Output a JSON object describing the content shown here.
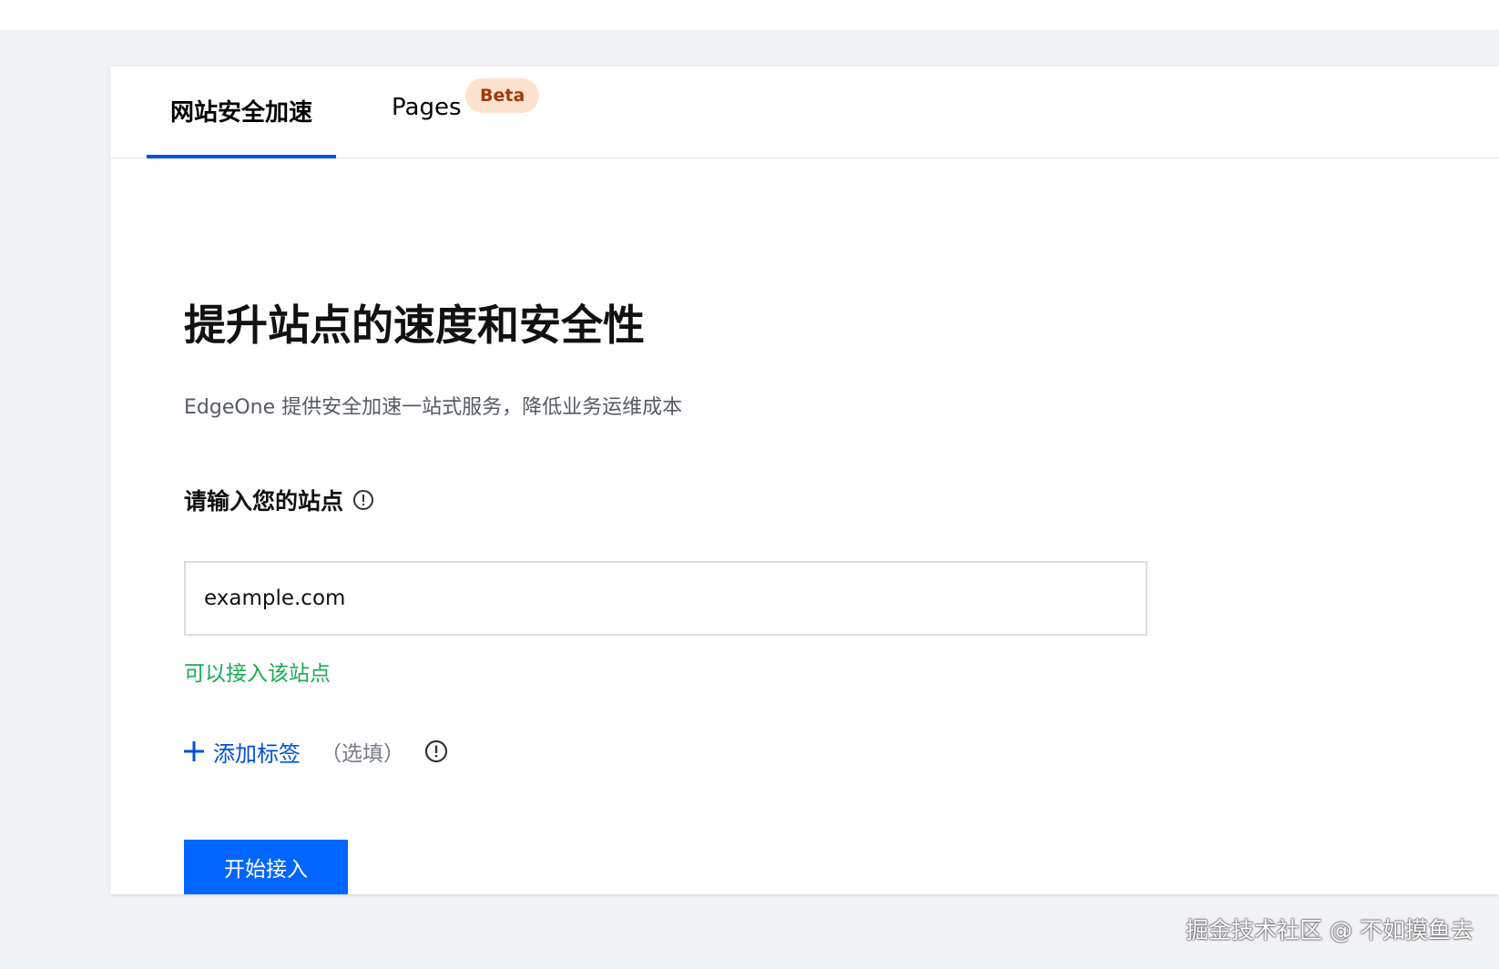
{
  "tabs": {
    "site_label": "网站安全加速",
    "pages_label": "Pages",
    "beta_badge": "Beta"
  },
  "hero": {
    "title": "提升站点的速度和安全性",
    "subtitle": "EdgeOne 提供安全加速一站式服务，降低业务运维成本"
  },
  "site_field": {
    "label": "请输入您的站点",
    "value": "example.com",
    "status": "可以接入该站点"
  },
  "tags": {
    "add_label": "添加标签",
    "optional": "（选填）"
  },
  "start_button": {
    "label": "开始接入"
  },
  "watermark": "掘金技术社区 @ 不如摸鱼去",
  "colors": {
    "accent": "#0052d9",
    "button": "#0066ff",
    "success": "#1aaa55",
    "badge_bg": "#fde3cf",
    "badge_text": "#a1390a"
  },
  "icons": {
    "field_info": "info-circle-icon",
    "tag_info": "info-circle-icon",
    "add": "plus-icon"
  }
}
